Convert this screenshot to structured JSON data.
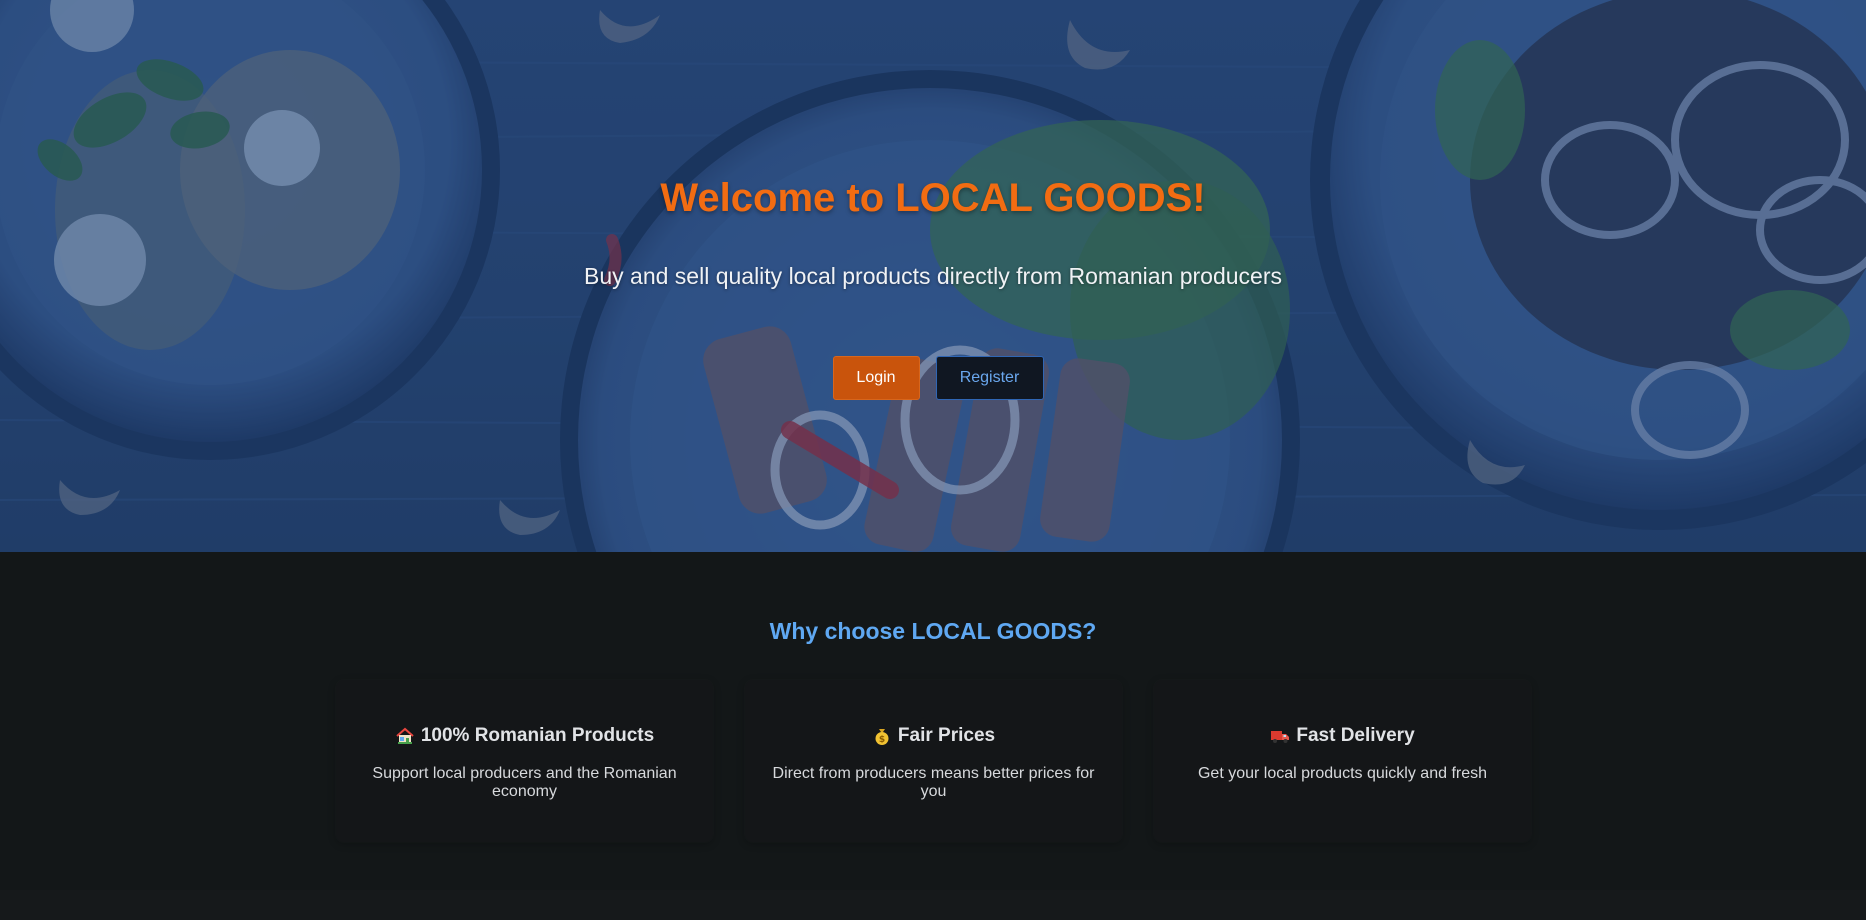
{
  "hero": {
    "title": "Welcome to LOCAL GOODS!",
    "subtitle": "Buy and sell quality local products directly from Romanian producers",
    "login_label": "Login",
    "register_label": "Register"
  },
  "features": {
    "title": "Why choose LOCAL GOODS?",
    "cards": [
      {
        "icon": "house-icon",
        "title": "100% Romanian Products",
        "description": "Support local producers and the Romanian economy"
      },
      {
        "icon": "money-bag-icon",
        "title": "Fair Prices",
        "description": "Direct from producers means better prices for you"
      },
      {
        "icon": "truck-icon",
        "title": "Fast Delivery",
        "description": "Get your local products quickly and fresh"
      }
    ]
  },
  "colors": {
    "accent_orange": "#f26c12",
    "button_login": "#c9540c",
    "link_blue": "#5fa8f2",
    "hero_overlay": "#274670",
    "page_background": "#131718"
  }
}
